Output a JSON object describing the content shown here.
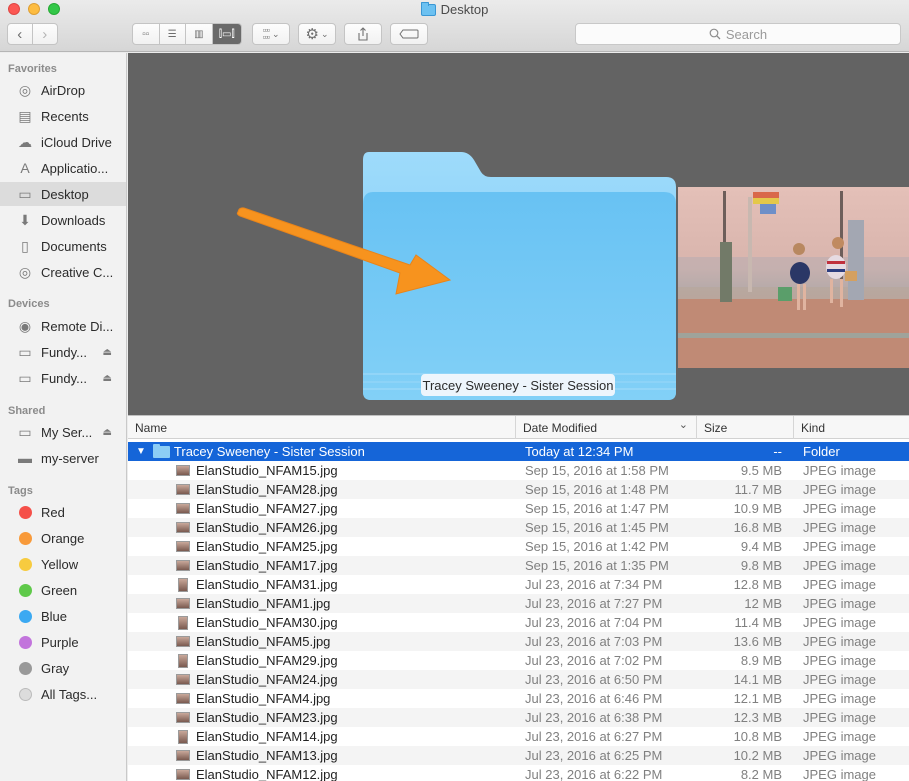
{
  "window": {
    "title": "Desktop",
    "title_icon": "folder-icon"
  },
  "toolbar": {
    "back_icon": "chevron-left-icon",
    "forward_icon": "chevron-right-icon",
    "view_modes": [
      {
        "name": "icon-view",
        "icon": "grid-icon",
        "glyph": "▫▫",
        "active": false
      },
      {
        "name": "list-view",
        "icon": "list-icon",
        "glyph": "☰",
        "active": false
      },
      {
        "name": "column-view",
        "icon": "columns-icon",
        "glyph": "▥",
        "active": false
      },
      {
        "name": "cover-flow-view",
        "icon": "cover-flow-icon",
        "glyph": "⫿▭⫿",
        "active": true
      }
    ],
    "arrange_icon": "arrange-grid-icon",
    "action_icon": "gear-icon",
    "share_icon": "share-icon",
    "tag_icon": "tag-icon",
    "search_placeholder": "Search"
  },
  "sidebar": {
    "sections": [
      {
        "header": "Favorites",
        "items": [
          {
            "label": "AirDrop",
            "icon": "airdrop-icon",
            "glyph": "◎"
          },
          {
            "label": "Recents",
            "icon": "recents-icon",
            "glyph": "▤"
          },
          {
            "label": "iCloud Drive",
            "icon": "cloud-icon",
            "glyph": "☁"
          },
          {
            "label": "Applicatio...",
            "icon": "applications-icon",
            "glyph": "A"
          },
          {
            "label": "Desktop",
            "icon": "desktop-icon",
            "glyph": "▭",
            "selected": true
          },
          {
            "label": "Downloads",
            "icon": "downloads-icon",
            "glyph": "⬇"
          },
          {
            "label": "Documents",
            "icon": "documents-icon",
            "glyph": "▯"
          },
          {
            "label": "Creative C...",
            "icon": "creative-cloud-icon",
            "glyph": "◎"
          }
        ]
      },
      {
        "header": "Devices",
        "items": [
          {
            "label": "Remote Di...",
            "icon": "disc-icon",
            "glyph": "◉"
          },
          {
            "label": "Fundy...",
            "icon": "drive-icon",
            "glyph": "▭",
            "eject": true
          },
          {
            "label": "Fundy...",
            "icon": "drive-icon",
            "glyph": "▭",
            "eject": true
          }
        ]
      },
      {
        "header": "Shared",
        "items": [
          {
            "label": "My Ser...",
            "icon": "monitor-icon",
            "glyph": "▭",
            "eject": true
          },
          {
            "label": "my-server",
            "icon": "monitor-icon",
            "glyph": "▬"
          }
        ]
      },
      {
        "header": "Tags",
        "items": [
          {
            "label": "Red",
            "color": "#f55049"
          },
          {
            "label": "Orange",
            "color": "#f89a3a"
          },
          {
            "label": "Yellow",
            "color": "#f7cb3f"
          },
          {
            "label": "Green",
            "color": "#5fc94a"
          },
          {
            "label": "Blue",
            "color": "#3ba9f2"
          },
          {
            "label": "Purple",
            "color": "#c274dc"
          },
          {
            "label": "Gray",
            "color": "#999999"
          },
          {
            "label": "All Tags...",
            "color": "#dcdcdc"
          }
        ]
      }
    ],
    "eject_glyph": "⏏"
  },
  "coverflow": {
    "folder_label": "Tracey Sweeney - Sister Session",
    "annotation": "orange-arrow"
  },
  "list": {
    "columns": {
      "name": "Name",
      "date": "Date Modified",
      "size": "Size",
      "kind": "Kind"
    },
    "sort_indicator": "⌄",
    "folder_row": {
      "name": "Tracey Sweeney - Sister Session",
      "date": "Today at 12:34 PM",
      "size": "--",
      "kind": "Folder",
      "expanded": true
    },
    "rows": [
      {
        "name": "ElanStudio_NFAM15.jpg",
        "date": "Sep 15, 2016 at 1:58 PM",
        "size": "9.5 MB",
        "kind": "JPEG image",
        "orient": "landscape"
      },
      {
        "name": "ElanStudio_NFAM28.jpg",
        "date": "Sep 15, 2016 at 1:48 PM",
        "size": "11.7 MB",
        "kind": "JPEG image",
        "orient": "landscape"
      },
      {
        "name": "ElanStudio_NFAM27.jpg",
        "date": "Sep 15, 2016 at 1:47 PM",
        "size": "10.9 MB",
        "kind": "JPEG image",
        "orient": "landscape"
      },
      {
        "name": "ElanStudio_NFAM26.jpg",
        "date": "Sep 15, 2016 at 1:45 PM",
        "size": "16.8 MB",
        "kind": "JPEG image",
        "orient": "landscape"
      },
      {
        "name": "ElanStudio_NFAM25.jpg",
        "date": "Sep 15, 2016 at 1:42 PM",
        "size": "9.4 MB",
        "kind": "JPEG image",
        "orient": "landscape"
      },
      {
        "name": "ElanStudio_NFAM17.jpg",
        "date": "Sep 15, 2016 at 1:35 PM",
        "size": "9.8 MB",
        "kind": "JPEG image",
        "orient": "landscape"
      },
      {
        "name": "ElanStudio_NFAM31.jpg",
        "date": "Jul 23, 2016 at 7:34 PM",
        "size": "12.8 MB",
        "kind": "JPEG image",
        "orient": "portrait"
      },
      {
        "name": "ElanStudio_NFAM1.jpg",
        "date": "Jul 23, 2016 at 7:27 PM",
        "size": "12 MB",
        "kind": "JPEG image",
        "orient": "landscape"
      },
      {
        "name": "ElanStudio_NFAM30.jpg",
        "date": "Jul 23, 2016 at 7:04 PM",
        "size": "11.4 MB",
        "kind": "JPEG image",
        "orient": "portrait"
      },
      {
        "name": "ElanStudio_NFAM5.jpg",
        "date": "Jul 23, 2016 at 7:03 PM",
        "size": "13.6 MB",
        "kind": "JPEG image",
        "orient": "landscape"
      },
      {
        "name": "ElanStudio_NFAM29.jpg",
        "date": "Jul 23, 2016 at 7:02 PM",
        "size": "8.9 MB",
        "kind": "JPEG image",
        "orient": "portrait"
      },
      {
        "name": "ElanStudio_NFAM24.jpg",
        "date": "Jul 23, 2016 at 6:50 PM",
        "size": "14.1 MB",
        "kind": "JPEG image",
        "orient": "landscape"
      },
      {
        "name": "ElanStudio_NFAM4.jpg",
        "date": "Jul 23, 2016 at 6:46 PM",
        "size": "12.1 MB",
        "kind": "JPEG image",
        "orient": "landscape"
      },
      {
        "name": "ElanStudio_NFAM23.jpg",
        "date": "Jul 23, 2016 at 6:38 PM",
        "size": "12.3 MB",
        "kind": "JPEG image",
        "orient": "landscape"
      },
      {
        "name": "ElanStudio_NFAM14.jpg",
        "date": "Jul 23, 2016 at 6:27 PM",
        "size": "10.8 MB",
        "kind": "JPEG image",
        "orient": "portrait"
      },
      {
        "name": "ElanStudio_NFAM13.jpg",
        "date": "Jul 23, 2016 at 6:25 PM",
        "size": "10.2 MB",
        "kind": "JPEG image",
        "orient": "landscape"
      },
      {
        "name": "ElanStudio_NFAM12.jpg",
        "date": "Jul 23, 2016 at 6:22 PM",
        "size": "8.2 MB",
        "kind": "JPEG image",
        "orient": "landscape"
      }
    ]
  }
}
